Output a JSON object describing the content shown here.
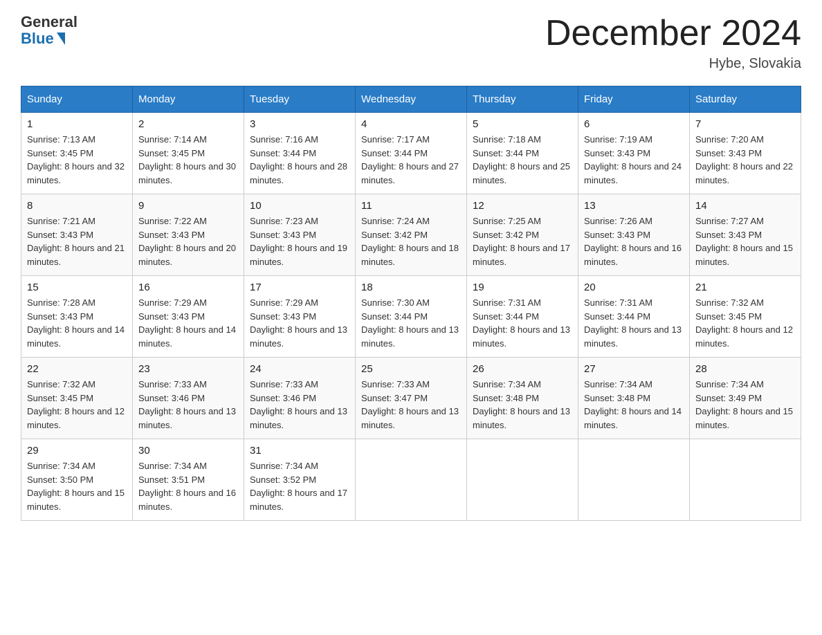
{
  "header": {
    "logo_general": "General",
    "logo_blue": "Blue",
    "month_title": "December 2024",
    "location": "Hybe, Slovakia"
  },
  "days_of_week": [
    "Sunday",
    "Monday",
    "Tuesday",
    "Wednesday",
    "Thursday",
    "Friday",
    "Saturday"
  ],
  "weeks": [
    [
      {
        "day": "1",
        "sunrise": "Sunrise: 7:13 AM",
        "sunset": "Sunset: 3:45 PM",
        "daylight": "Daylight: 8 hours and 32 minutes."
      },
      {
        "day": "2",
        "sunrise": "Sunrise: 7:14 AM",
        "sunset": "Sunset: 3:45 PM",
        "daylight": "Daylight: 8 hours and 30 minutes."
      },
      {
        "day": "3",
        "sunrise": "Sunrise: 7:16 AM",
        "sunset": "Sunset: 3:44 PM",
        "daylight": "Daylight: 8 hours and 28 minutes."
      },
      {
        "day": "4",
        "sunrise": "Sunrise: 7:17 AM",
        "sunset": "Sunset: 3:44 PM",
        "daylight": "Daylight: 8 hours and 27 minutes."
      },
      {
        "day": "5",
        "sunrise": "Sunrise: 7:18 AM",
        "sunset": "Sunset: 3:44 PM",
        "daylight": "Daylight: 8 hours and 25 minutes."
      },
      {
        "day": "6",
        "sunrise": "Sunrise: 7:19 AM",
        "sunset": "Sunset: 3:43 PM",
        "daylight": "Daylight: 8 hours and 24 minutes."
      },
      {
        "day": "7",
        "sunrise": "Sunrise: 7:20 AM",
        "sunset": "Sunset: 3:43 PM",
        "daylight": "Daylight: 8 hours and 22 minutes."
      }
    ],
    [
      {
        "day": "8",
        "sunrise": "Sunrise: 7:21 AM",
        "sunset": "Sunset: 3:43 PM",
        "daylight": "Daylight: 8 hours and 21 minutes."
      },
      {
        "day": "9",
        "sunrise": "Sunrise: 7:22 AM",
        "sunset": "Sunset: 3:43 PM",
        "daylight": "Daylight: 8 hours and 20 minutes."
      },
      {
        "day": "10",
        "sunrise": "Sunrise: 7:23 AM",
        "sunset": "Sunset: 3:43 PM",
        "daylight": "Daylight: 8 hours and 19 minutes."
      },
      {
        "day": "11",
        "sunrise": "Sunrise: 7:24 AM",
        "sunset": "Sunset: 3:42 PM",
        "daylight": "Daylight: 8 hours and 18 minutes."
      },
      {
        "day": "12",
        "sunrise": "Sunrise: 7:25 AM",
        "sunset": "Sunset: 3:42 PM",
        "daylight": "Daylight: 8 hours and 17 minutes."
      },
      {
        "day": "13",
        "sunrise": "Sunrise: 7:26 AM",
        "sunset": "Sunset: 3:43 PM",
        "daylight": "Daylight: 8 hours and 16 minutes."
      },
      {
        "day": "14",
        "sunrise": "Sunrise: 7:27 AM",
        "sunset": "Sunset: 3:43 PM",
        "daylight": "Daylight: 8 hours and 15 minutes."
      }
    ],
    [
      {
        "day": "15",
        "sunrise": "Sunrise: 7:28 AM",
        "sunset": "Sunset: 3:43 PM",
        "daylight": "Daylight: 8 hours and 14 minutes."
      },
      {
        "day": "16",
        "sunrise": "Sunrise: 7:29 AM",
        "sunset": "Sunset: 3:43 PM",
        "daylight": "Daylight: 8 hours and 14 minutes."
      },
      {
        "day": "17",
        "sunrise": "Sunrise: 7:29 AM",
        "sunset": "Sunset: 3:43 PM",
        "daylight": "Daylight: 8 hours and 13 minutes."
      },
      {
        "day": "18",
        "sunrise": "Sunrise: 7:30 AM",
        "sunset": "Sunset: 3:44 PM",
        "daylight": "Daylight: 8 hours and 13 minutes."
      },
      {
        "day": "19",
        "sunrise": "Sunrise: 7:31 AM",
        "sunset": "Sunset: 3:44 PM",
        "daylight": "Daylight: 8 hours and 13 minutes."
      },
      {
        "day": "20",
        "sunrise": "Sunrise: 7:31 AM",
        "sunset": "Sunset: 3:44 PM",
        "daylight": "Daylight: 8 hours and 13 minutes."
      },
      {
        "day": "21",
        "sunrise": "Sunrise: 7:32 AM",
        "sunset": "Sunset: 3:45 PM",
        "daylight": "Daylight: 8 hours and 12 minutes."
      }
    ],
    [
      {
        "day": "22",
        "sunrise": "Sunrise: 7:32 AM",
        "sunset": "Sunset: 3:45 PM",
        "daylight": "Daylight: 8 hours and 12 minutes."
      },
      {
        "day": "23",
        "sunrise": "Sunrise: 7:33 AM",
        "sunset": "Sunset: 3:46 PM",
        "daylight": "Daylight: 8 hours and 13 minutes."
      },
      {
        "day": "24",
        "sunrise": "Sunrise: 7:33 AM",
        "sunset": "Sunset: 3:46 PM",
        "daylight": "Daylight: 8 hours and 13 minutes."
      },
      {
        "day": "25",
        "sunrise": "Sunrise: 7:33 AM",
        "sunset": "Sunset: 3:47 PM",
        "daylight": "Daylight: 8 hours and 13 minutes."
      },
      {
        "day": "26",
        "sunrise": "Sunrise: 7:34 AM",
        "sunset": "Sunset: 3:48 PM",
        "daylight": "Daylight: 8 hours and 13 minutes."
      },
      {
        "day": "27",
        "sunrise": "Sunrise: 7:34 AM",
        "sunset": "Sunset: 3:48 PM",
        "daylight": "Daylight: 8 hours and 14 minutes."
      },
      {
        "day": "28",
        "sunrise": "Sunrise: 7:34 AM",
        "sunset": "Sunset: 3:49 PM",
        "daylight": "Daylight: 8 hours and 15 minutes."
      }
    ],
    [
      {
        "day": "29",
        "sunrise": "Sunrise: 7:34 AM",
        "sunset": "Sunset: 3:50 PM",
        "daylight": "Daylight: 8 hours and 15 minutes."
      },
      {
        "day": "30",
        "sunrise": "Sunrise: 7:34 AM",
        "sunset": "Sunset: 3:51 PM",
        "daylight": "Daylight: 8 hours and 16 minutes."
      },
      {
        "day": "31",
        "sunrise": "Sunrise: 7:34 AM",
        "sunset": "Sunset: 3:52 PM",
        "daylight": "Daylight: 8 hours and 17 minutes."
      },
      null,
      null,
      null,
      null
    ]
  ]
}
